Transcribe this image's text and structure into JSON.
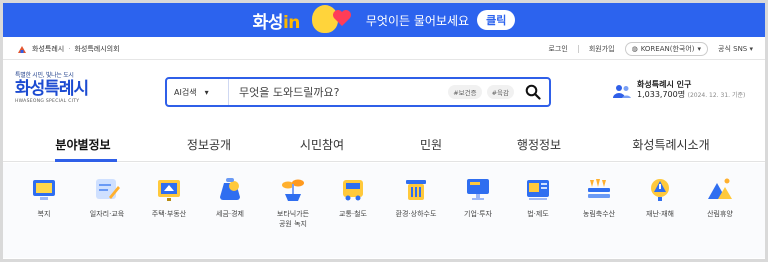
{
  "banner": {
    "brand": "화성",
    "brand_in": "in",
    "message": "무엇이든 물어보세요",
    "button": "클릭"
  },
  "util": {
    "breadcrumb": [
      "화성특례시",
      "화성특례시의회"
    ],
    "login": "로그인",
    "join": "회원가입",
    "language": "KOREAN(한국어)",
    "sns": "공식 SNS"
  },
  "logo": {
    "tagline": "특별한 시민, 빛나는 도시",
    "name": "화성특례시",
    "english": "HWASEONG SPECIAL CITY"
  },
  "search": {
    "scope": "AI검색",
    "placeholder": "무엇을 도와드릴까요?",
    "chips": [
      "#보건증",
      "#육감"
    ]
  },
  "population": {
    "label": "화성특례시 인구",
    "value": "1,033,700명",
    "date": "(2024. 12. 31. 기준)"
  },
  "nav": {
    "tabs": [
      "분야별정보",
      "정보공개",
      "시민참여",
      "민원",
      "행정정보",
      "화성특례시소개"
    ],
    "active_index": 0
  },
  "categories": [
    {
      "label": "복지",
      "icon": "tv-welfare-icon"
    },
    {
      "label": "일자리·교육",
      "icon": "pencil-board-icon"
    },
    {
      "label": "주택·부동산",
      "icon": "house-board-icon"
    },
    {
      "label": "세금·경제",
      "icon": "coin-bag-icon"
    },
    {
      "label": "보타닉가든\n공원 녹지",
      "icon": "sprout-icon"
    },
    {
      "label": "교통·철도",
      "icon": "bus-icon"
    },
    {
      "label": "환경·상하수도",
      "icon": "recycle-bin-icon"
    },
    {
      "label": "기업·투자",
      "icon": "monitor-icon"
    },
    {
      "label": "법·제도",
      "icon": "law-board-icon"
    },
    {
      "label": "농림축수산",
      "icon": "farm-crops-icon"
    },
    {
      "label": "재난·재해",
      "icon": "warning-sign-icon"
    },
    {
      "label": "산림휴양",
      "icon": "mountain-icon"
    }
  ]
}
